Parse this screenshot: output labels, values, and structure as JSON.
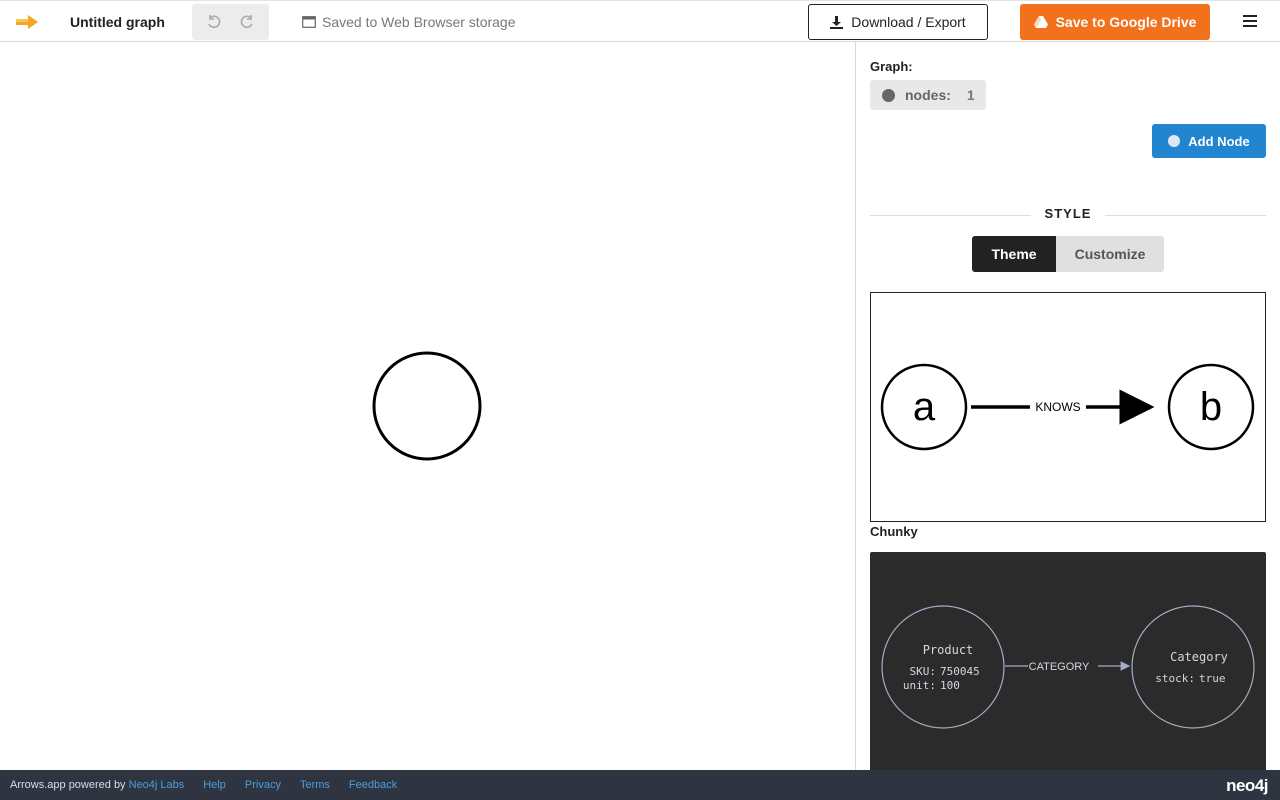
{
  "header": {
    "title": "Untitled graph",
    "saved_status": "Saved to Web Browser storage",
    "download_label": "Download / Export",
    "drive_label": "Save to Google Drive"
  },
  "panel": {
    "graph_label": "Graph:",
    "nodes_label": "nodes:",
    "nodes_count": "1",
    "add_node_label": "Add Node",
    "style_heading": "STYLE",
    "tabs": [
      {
        "label": "Theme",
        "active": true
      },
      {
        "label": "Customize",
        "active": false
      }
    ],
    "themes": [
      {
        "name": "Chunky",
        "node_a": "a",
        "node_b": "b",
        "relationship": "KNOWS"
      },
      {
        "node_a_caption": "Product",
        "node_a_props": [
          {
            "key": "SKU:",
            "value": "750045"
          },
          {
            "key": "unit:",
            "value": "100"
          }
        ],
        "relationship": "CATEGORY",
        "node_b_caption": "Category",
        "node_b_props": [
          {
            "key": "stock:",
            "value": "true"
          }
        ]
      }
    ]
  },
  "footer": {
    "powered_text": "Arrows.app powered by",
    "powered_link": "Neo4j Labs",
    "links": [
      "Help",
      "Privacy",
      "Terms",
      "Feedback"
    ],
    "brand": "neo4j"
  },
  "colors": {
    "accent_orange": "#f2711c",
    "accent_blue": "#2185d0",
    "footer_bg": "#2e3440"
  }
}
